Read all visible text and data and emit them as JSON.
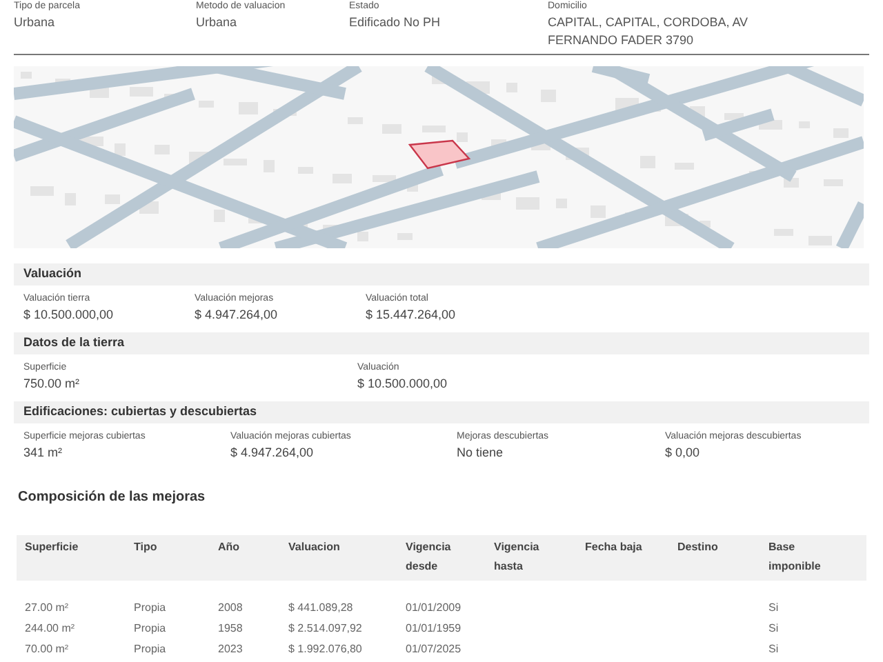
{
  "parcel_summary": [
    {
      "label": "Tipo de parcela",
      "value": [
        "Urbana"
      ]
    },
    {
      "label": "Metodo de valuacion",
      "value": [
        "Urbana"
      ]
    },
    {
      "label": "Estado",
      "value": [
        "Edificado No PH"
      ]
    },
    {
      "label": "Domicilio",
      "value": [
        "CAPITAL, CAPITAL, CORDOBA, AV",
        "FERNANDO FADER 3790"
      ]
    }
  ],
  "sections": [
    {
      "title": "Valuación",
      "fields": [
        {
          "label": "Valuación tierra",
          "value": "$ 10.500.000,00"
        },
        {
          "label": "Valuación mejoras",
          "value": "$ 4.947.264,00"
        },
        {
          "label": "Valuación total",
          "value": "$ 15.447.264,00"
        }
      ]
    },
    {
      "title": "Datos de la tierra",
      "fields": [
        {
          "label": "Superficie",
          "value": "750.00 m²"
        },
        {
          "label": "Valuación",
          "value": "$ 10.500.000,00"
        }
      ]
    },
    {
      "title": "Edificaciones: cubiertas y descubiertas",
      "fields": [
        {
          "label": "Superficie mejoras cubiertas",
          "value": "341 m²"
        },
        {
          "label": "Valuación mejoras cubiertas",
          "value": "$ 4.947.264,00"
        },
        {
          "label": "Mejoras descubiertas",
          "value": "No tiene"
        },
        {
          "label": "Valuación mejoras descubiertas",
          "value": "$ 0,00"
        }
      ]
    }
  ],
  "mejoras": {
    "title": "Composición de las mejoras",
    "columns": [
      "Superficie",
      "Tipo",
      "Año",
      "Valuacion",
      "Vigencia desde",
      "Vigencia hasta",
      "Fecha baja",
      "Destino",
      "Base imponible"
    ],
    "rows": [
      {
        "superficie": "27.00 m²",
        "tipo": "Propia",
        "anio": "2008",
        "valuacion": "$ 441.089,28",
        "vigencia_desde": "01/01/2009",
        "base_imponible": "Si"
      },
      {
        "superficie": "244.00 m²",
        "tipo": "Propia",
        "anio": "1958",
        "valuacion": "$ 2.514.097,92",
        "vigencia_desde": "01/01/1959",
        "base_imponible": "Si"
      },
      {
        "superficie": "70.00 m²",
        "tipo": "Propia",
        "anio": "2023",
        "valuacion": "$ 1.992.076,80",
        "vigencia_desde": "01/07/2025",
        "base_imponible": "Si"
      }
    ]
  }
}
